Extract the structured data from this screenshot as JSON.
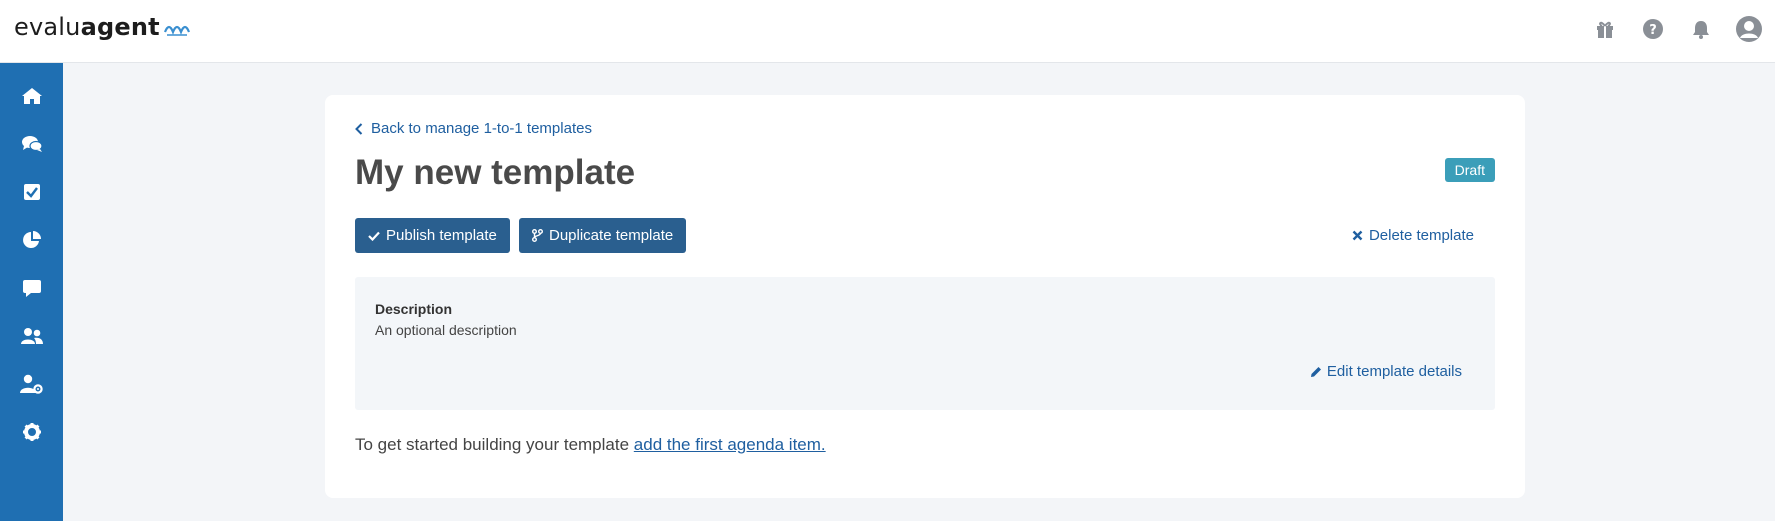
{
  "header": {
    "logo_light": "evalu",
    "logo_bold": "agent",
    "icons": [
      "gift-icon",
      "help-icon",
      "bell-icon",
      "user-avatar-icon"
    ]
  },
  "sidebar": {
    "items": [
      {
        "icon": "home-icon"
      },
      {
        "icon": "conversations-icon"
      },
      {
        "icon": "checkbox-icon"
      },
      {
        "icon": "pie-chart-icon"
      },
      {
        "icon": "chat-icon"
      },
      {
        "icon": "users-icon"
      },
      {
        "icon": "user-settings-icon"
      },
      {
        "icon": "gear-icon"
      }
    ]
  },
  "page": {
    "back_link": "Back to manage 1-to-1 templates",
    "title": "My new template",
    "status_badge": "Draft",
    "publish_button": "Publish template",
    "duplicate_button": "Duplicate template",
    "delete_link": "Delete template",
    "description": {
      "label": "Description",
      "text": "An optional description",
      "edit_link": "Edit template details"
    },
    "starter_text": "To get started building your template",
    "starter_link": "add the first agenda item."
  },
  "colors": {
    "sidebar": "#1f6fb2",
    "button": "#2a5f8f",
    "badge": "#3b9eb9",
    "link": "#1f5fa0",
    "background": "#f3f5f8"
  }
}
